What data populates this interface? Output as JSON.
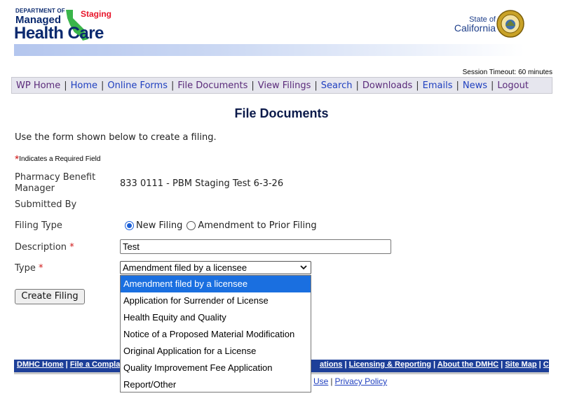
{
  "header": {
    "dept_label": "DEPARTMENT OF",
    "brand_line1": "Managed",
    "brand_line2": "Health Care",
    "staging": "Staging",
    "state_line1": "State of",
    "state_line2": "California",
    "gradient_colors": [
      "#b4c6ee",
      "#ffffff"
    ]
  },
  "session_timeout": "Session Timeout: 60 minutes",
  "nav": {
    "items": [
      {
        "label": "WP Home",
        "color": "#5a2a7a"
      },
      {
        "label": "Home",
        "color": "#1f3fbf"
      },
      {
        "label": "Online Forms",
        "color": "#1f3fbf"
      },
      {
        "label": "File Documents",
        "color": "#5a2a7a"
      },
      {
        "label": "View Filings",
        "color": "#5a2a7a"
      },
      {
        "label": "Search",
        "color": "#1f3fbf"
      },
      {
        "label": "Downloads",
        "color": "#5a2a7a"
      },
      {
        "label": "Emails",
        "color": "#1f3fbf"
      },
      {
        "label": "News",
        "color": "#1f3fbf"
      },
      {
        "label": "Logout",
        "color": "#5a2a7a"
      }
    ],
    "separator": "|"
  },
  "page": {
    "title": "File Documents",
    "intro": "Use the form shown below to create a filing.",
    "required_note": "Indicates a Required Field",
    "required_star": "*"
  },
  "form": {
    "pbm_label": "Pharmacy Benefit Manager",
    "pbm_value": "833 0111 - PBM Staging Test 6-3-26",
    "submitted_by_label": "Submitted By",
    "filing_type_label": "Filing Type",
    "filing_type_options": [
      "New Filing",
      "Amendment to Prior Filing"
    ],
    "filing_type_selected": "New Filing",
    "description_label": "Description",
    "description_value": "Test",
    "type_label": "Type",
    "type_selected": "Amendment filed by a licensee",
    "type_options": [
      "Amendment filed by a licensee",
      "Application for Surrender of License",
      "Health Equity and Quality",
      "Notice of a Proposed Material Modification",
      "Original Application for a License",
      "Quality Improvement Fee Application",
      "Report/Other"
    ],
    "submit_label": "Create Filing"
  },
  "footer": {
    "nav_left": [
      "DMHC Home",
      "File a Complai"
    ],
    "nav_right": [
      "ations",
      "Licensing & Reporting",
      "About the DMHC",
      "Site Map",
      "Contact"
    ],
    "links": [
      "Use",
      "Privacy Policy"
    ]
  }
}
